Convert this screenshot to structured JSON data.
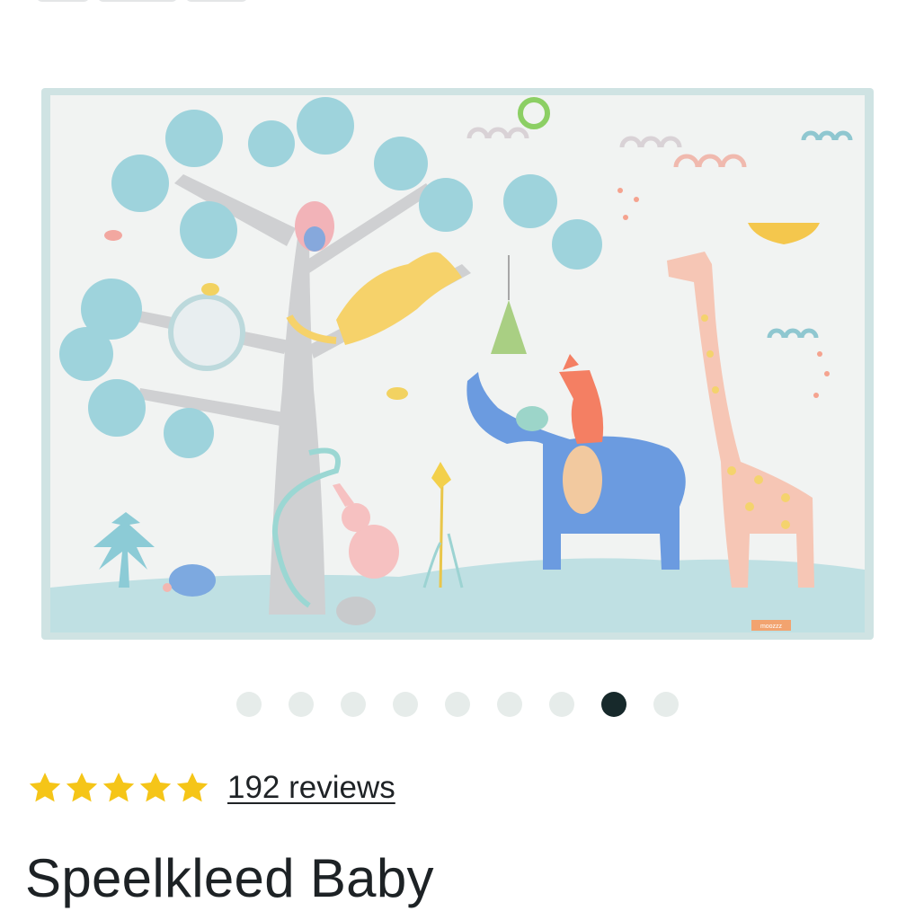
{
  "product": {
    "title": "Speelkleed Baby",
    "image_alt": "Speelkleed Baby",
    "mat_brand_tag": "moozzz"
  },
  "gallery": {
    "total": 9,
    "active_index": 7
  },
  "rating": {
    "stars": 5,
    "reviews_label": "192 reviews"
  },
  "colors": {
    "star": "#f5c518",
    "dot_active": "#17292b",
    "dot_inactive": "#e6ecea"
  },
  "icons": {
    "star": "star-icon"
  }
}
